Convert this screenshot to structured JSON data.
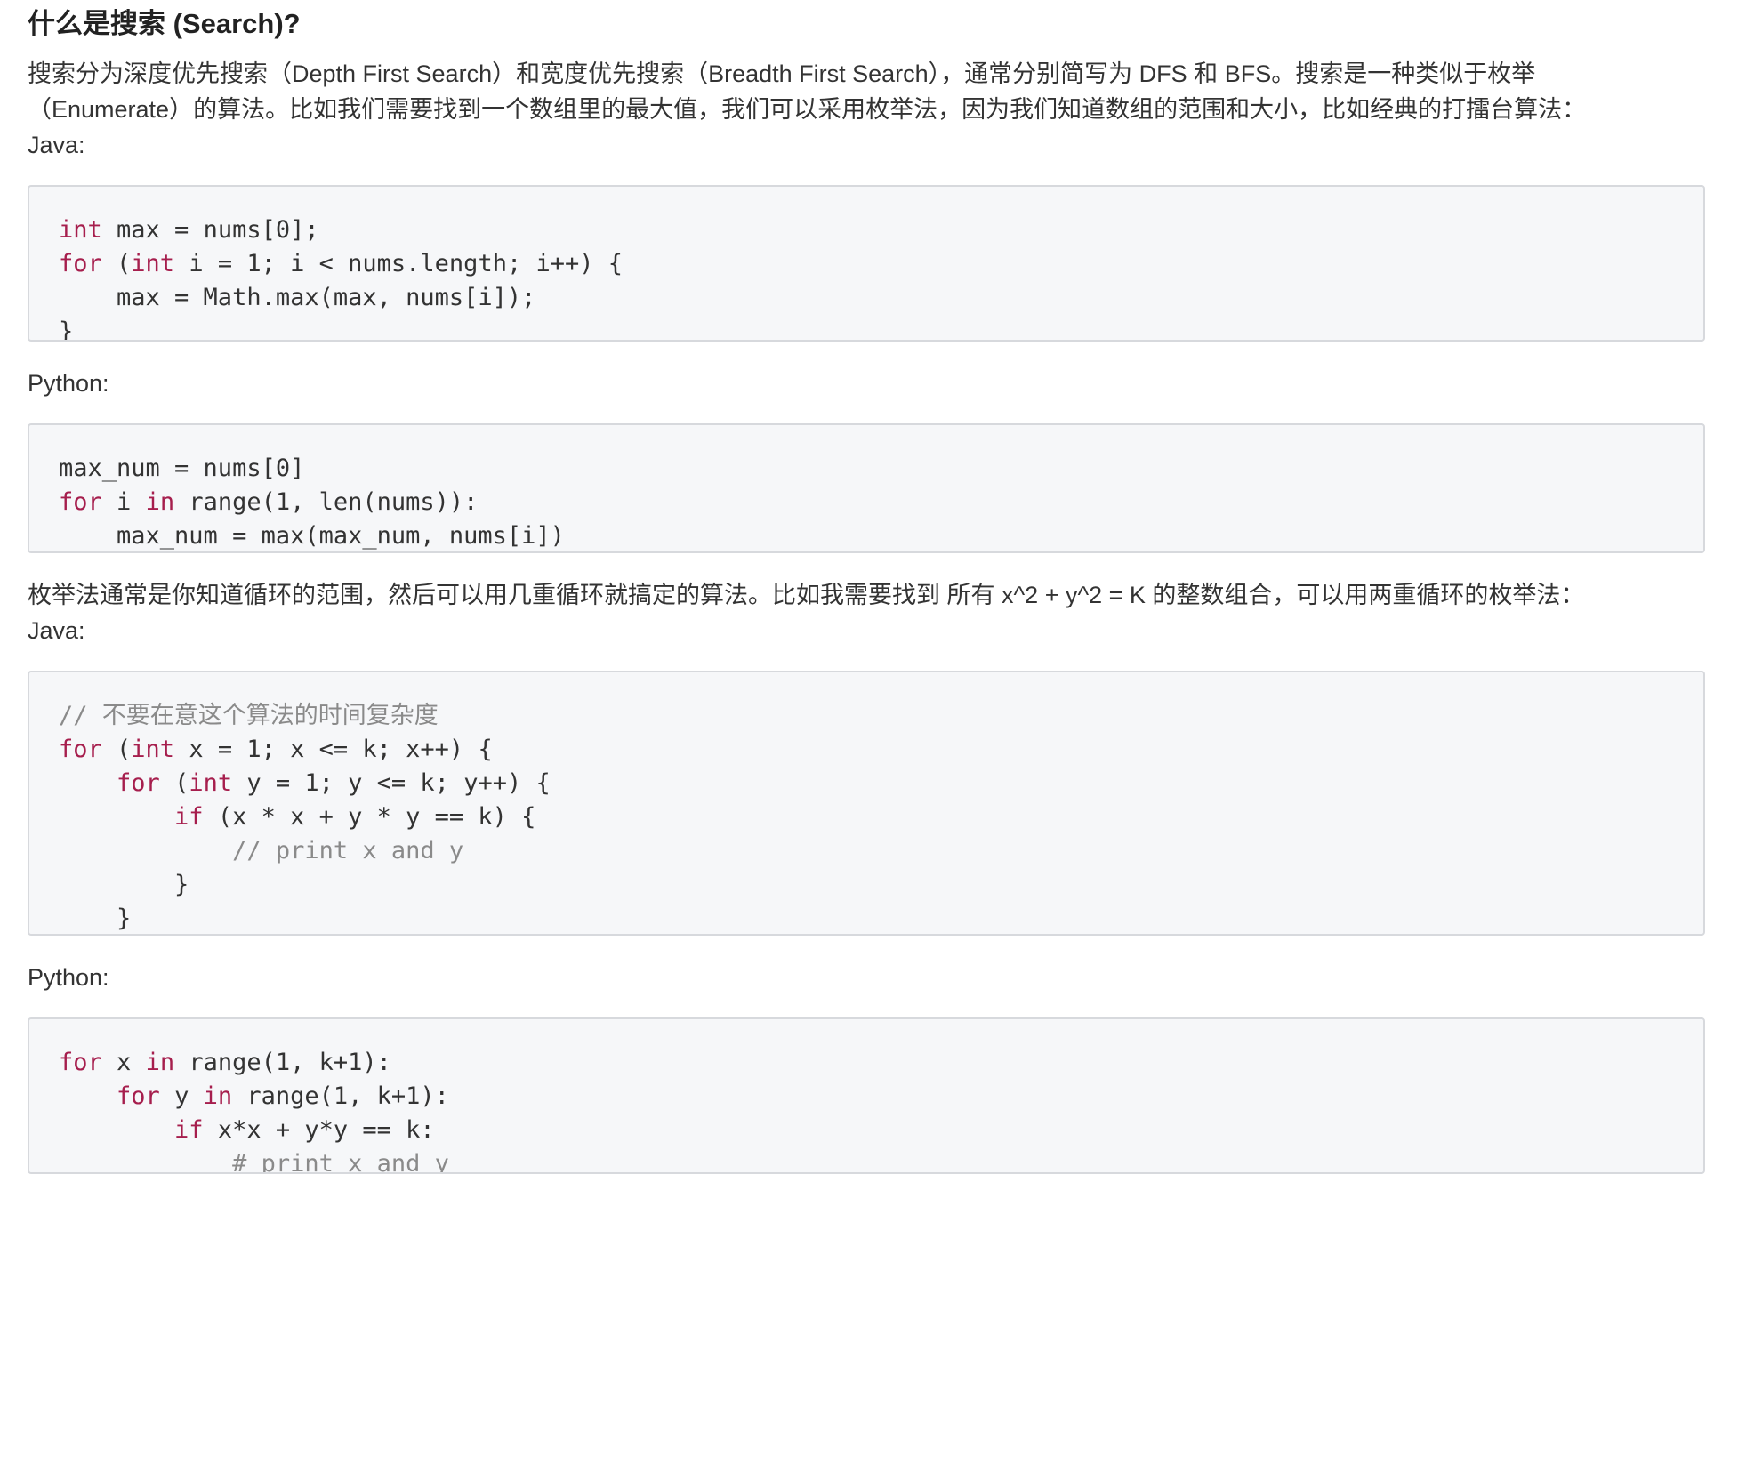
{
  "heading": "什么是搜索 (Search)?",
  "intro": {
    "line1": "搜索分为深度优先搜索（Depth First Search）和宽度优先搜索（Breadth First Search），通常分别简写为 DFS 和 BFS。搜索是一种类似于枚举",
    "line2": "（Enumerate）的算法。比如我们需要找到一个数组里的最大值，我们可以采用枚举法，因为我们知道数组的范围和大小，比如经典的打擂台算法："
  },
  "labels": {
    "java1": "Java:",
    "python1": "Python:",
    "java2": "Java:",
    "python2": "Python:"
  },
  "middle_paragraph": "枚举法通常是你知道循环的范围，然后可以用几重循环就搞定的算法。比如我需要找到 所有 x^2 + y^2 = K 的整数组合，可以用两重循环的枚举法：",
  "code_blocks": {
    "java_max": [
      [
        {
          "t": "int",
          "k": 1
        },
        {
          "t": " max = nums[0];"
        }
      ],
      [
        {
          "t": "for",
          "k": 1
        },
        {
          "t": " ("
        },
        {
          "t": "int",
          "k": 1
        },
        {
          "t": " i = 1; i < nums.length; i++) {"
        }
      ],
      [
        {
          "t": "    max = Math.max(max, nums[i]);"
        }
      ],
      [
        {
          "t": "}"
        }
      ]
    ],
    "python_max": [
      [
        {
          "t": "max_num = nums[0]"
        }
      ],
      [
        {
          "t": "for",
          "k": 1
        },
        {
          "t": " i "
        },
        {
          "t": "in",
          "k": 1
        },
        {
          "t": " range(1, len(nums)):"
        }
      ],
      [
        {
          "t": "    max_num = max(max_num, nums[i])"
        }
      ]
    ],
    "java_enum": [
      [
        {
          "t": "// 不要在意这个算法的时间复杂度",
          "c": 1
        }
      ],
      [
        {
          "t": "for",
          "k": 1
        },
        {
          "t": " ("
        },
        {
          "t": "int",
          "k": 1
        },
        {
          "t": " x = 1; x <= k; x++) {"
        }
      ],
      [
        {
          "t": "    "
        },
        {
          "t": "for",
          "k": 1
        },
        {
          "t": " ("
        },
        {
          "t": "int",
          "k": 1
        },
        {
          "t": " y = 1; y <= k; y++) {"
        }
      ],
      [
        {
          "t": "        "
        },
        {
          "t": "if",
          "k": 1
        },
        {
          "t": " (x * x + y * y == k) {"
        }
      ],
      [
        {
          "t": "            "
        },
        {
          "t": "// print x and y",
          "c": 1
        }
      ],
      [
        {
          "t": "        }"
        }
      ],
      [
        {
          "t": "    }"
        }
      ],
      [
        {
          "t": "}"
        }
      ]
    ],
    "python_enum": [
      [
        {
          "t": "for",
          "k": 1
        },
        {
          "t": " x "
        },
        {
          "t": "in",
          "k": 1
        },
        {
          "t": " range(1, k+1):"
        }
      ],
      [
        {
          "t": "    "
        },
        {
          "t": "for",
          "k": 1
        },
        {
          "t": " y "
        },
        {
          "t": "in",
          "k": 1
        },
        {
          "t": " range(1, k+1):"
        }
      ],
      [
        {
          "t": "        "
        },
        {
          "t": "if",
          "k": 1
        },
        {
          "t": " x*x + y*y == k:"
        }
      ],
      [
        {
          "t": "            "
        },
        {
          "t": "# print x and y",
          "c": 1
        }
      ]
    ]
  },
  "colors": {
    "keyword": "#a61e4d",
    "comment": "#8a8a8a",
    "code_background": "#f6f7f9",
    "code_border": "#d7d9dd"
  }
}
